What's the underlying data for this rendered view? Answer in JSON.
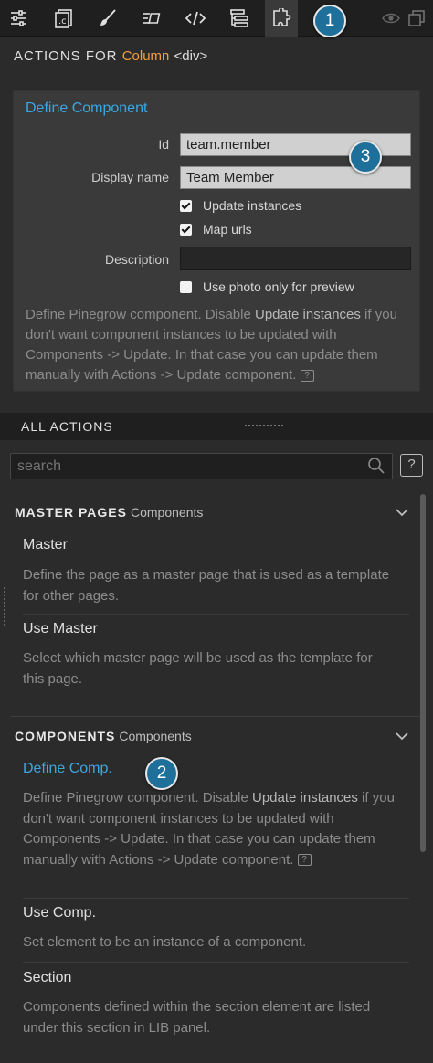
{
  "toolbar": {
    "tabs": [
      {
        "name": "properties-icon",
        "glyph": "properties"
      },
      {
        "name": "css-icon",
        "glyph": "css"
      },
      {
        "name": "style-brush-icon",
        "glyph": "brush"
      },
      {
        "name": "text-format-icon",
        "glyph": "text"
      },
      {
        "name": "code-icon",
        "glyph": "code"
      },
      {
        "name": "tree-icon",
        "glyph": "tree"
      },
      {
        "name": "actions-puzzle-icon",
        "glyph": "puzzle",
        "active": true
      }
    ],
    "right_icons": [
      "eye-icon",
      "detach-window-icon"
    ]
  },
  "callouts": {
    "one": "1",
    "two": "2",
    "three": "3"
  },
  "header": {
    "prefix": "ACTIONS FOR",
    "element": "Column",
    "tag": "<div>"
  },
  "define_component": {
    "title": "Define Component",
    "id_label": "Id",
    "id_value": "team.member",
    "display_name_label": "Display name",
    "display_name_value": "Team Member",
    "update_instances_label": "Update instances",
    "update_instances_checked": true,
    "map_urls_label": "Map urls",
    "map_urls_checked": true,
    "description_label": "Description",
    "description_value": "",
    "photo_preview_label": "Use photo only for preview",
    "photo_preview_checked": false,
    "help_1": "Define Pinegrow component. Disable ",
    "help_em": "Update instances",
    "help_2": " if you don't want component instances to be updated with Components -> Update. In that case you can update them manually with Actions -> Update component.",
    "help_icon": "?"
  },
  "all_actions": {
    "title": "ALL ACTIONS",
    "search_placeholder": "search",
    "search_help": "?"
  },
  "master_pages": {
    "title": "MASTER PAGES",
    "subtitle": "Components",
    "items": [
      {
        "title": "Master",
        "desc": "Define the page as a master page that is used as a template for other pages."
      },
      {
        "title": "Use Master",
        "desc": "Select which master page will be used as the template for this page."
      }
    ]
  },
  "components": {
    "title": "COMPONENTS",
    "subtitle": "Components",
    "define": {
      "title": "Define Comp.",
      "desc_1": "Define Pinegrow component. Disable ",
      "desc_em": "Update instances",
      "desc_2": " if you don't want component instances to be updated with Components -> Update. In that case you can update them manually with Actions -> Update component.",
      "help_icon": "?"
    },
    "use": {
      "title": "Use Comp.",
      "desc": "Set element to be an instance of a component."
    },
    "section": {
      "title": "Section",
      "desc": "Components defined within the section element are listed under this section in LIB panel."
    }
  },
  "colors": {
    "accent_blue": "#3aa7e0",
    "element_orange": "#f0a040",
    "callout_blue": "#1e6f9a"
  }
}
